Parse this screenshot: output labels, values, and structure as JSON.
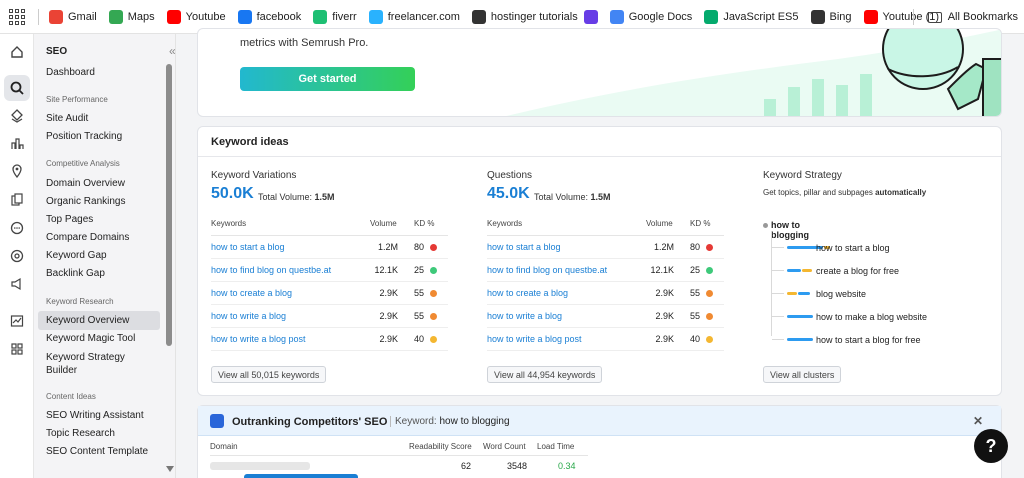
{
  "bookmarks": {
    "items": [
      {
        "label": "Gmail",
        "icon": "gmail-icon",
        "color": "#ea4335"
      },
      {
        "label": "Maps",
        "icon": "maps-icon",
        "color": "#34a853"
      },
      {
        "label": "Youtube",
        "icon": "youtube-icon",
        "color": "#ff0000"
      },
      {
        "label": "facebook",
        "icon": "facebook-icon",
        "color": "#1877f2"
      },
      {
        "label": "fiverr",
        "icon": "fiverr-icon",
        "color": "#1dbf73"
      },
      {
        "label": "freelancer.com",
        "icon": "freelancer-icon",
        "color": "#29b2fe"
      },
      {
        "label": "hostinger tutorials",
        "icon": "globe-icon",
        "color": "#333333"
      },
      {
        "label": "",
        "icon": "hostinger-icon",
        "color": "#673de6"
      },
      {
        "label": "Google Docs",
        "icon": "docs-icon",
        "color": "#4285f4"
      },
      {
        "label": "JavaScript ES5",
        "icon": "w3schools-icon",
        "color": "#04aa6d"
      },
      {
        "label": "Bing",
        "icon": "globe-icon",
        "color": "#333333"
      },
      {
        "label": "Youtube (1)",
        "icon": "youtube-icon",
        "color": "#ff0000"
      }
    ],
    "all_bookmarks": "All Bookmarks"
  },
  "nav": {
    "title": "SEO",
    "dashboard": "Dashboard",
    "site_performance": {
      "heading": "Site Performance",
      "items": [
        "Site Audit",
        "Position Tracking"
      ]
    },
    "competitive": {
      "heading": "Competitive Analysis",
      "items": [
        "Domain Overview",
        "Organic Rankings",
        "Top Pages",
        "Compare Domains",
        "Keyword Gap",
        "Backlink Gap"
      ]
    },
    "keyword_research": {
      "heading": "Keyword Research",
      "items": [
        "Keyword Overview",
        "Keyword Magic Tool",
        "Keyword Strategy Builder"
      ],
      "selected": "Keyword Overview"
    },
    "content_ideas": {
      "heading": "Content Ideas",
      "items": [
        "SEO Writing Assistant",
        "Topic Research",
        "SEO Content Template"
      ]
    }
  },
  "promo": {
    "text": "metrics with Semrush Pro.",
    "button": "Get started"
  },
  "keyword_ideas": {
    "title": "Keyword ideas",
    "variations": {
      "title": "Keyword Variations",
      "count": "50.0K",
      "volume_label": "Total Volume:",
      "volume": "1.5M",
      "columns": [
        "Keywords",
        "Volume",
        "KD %"
      ],
      "rows": [
        {
          "keyword": "how to start a blog",
          "volume": "1.2M",
          "kd": "80",
          "color": "#e53935"
        },
        {
          "keyword": "how to find blog on questbe.at",
          "volume": "12.1K",
          "kd": "25",
          "color": "#3ec97a"
        },
        {
          "keyword": "how to create a blog",
          "volume": "2.9K",
          "kd": "55",
          "color": "#f08a32"
        },
        {
          "keyword": "how to write a blog",
          "volume": "2.9K",
          "kd": "55",
          "color": "#f08a32"
        },
        {
          "keyword": "how to write a blog post",
          "volume": "2.9K",
          "kd": "40",
          "color": "#f4b731"
        }
      ],
      "view_all": "View all 50,015 keywords"
    },
    "questions": {
      "title": "Questions",
      "count": "45.0K",
      "volume_label": "Total Volume:",
      "volume": "1.5M",
      "columns": [
        "Keywords",
        "Volume",
        "KD %"
      ],
      "rows": [
        {
          "keyword": "how to start a blog",
          "volume": "1.2M",
          "kd": "80",
          "color": "#e53935"
        },
        {
          "keyword": "how to find blog on questbe.at",
          "volume": "12.1K",
          "kd": "25",
          "color": "#3ec97a"
        },
        {
          "keyword": "how to create a blog",
          "volume": "2.9K",
          "kd": "55",
          "color": "#f08a32"
        },
        {
          "keyword": "how to write a blog",
          "volume": "2.9K",
          "kd": "55",
          "color": "#f08a32"
        },
        {
          "keyword": "how to write a blog post",
          "volume": "2.9K",
          "kd": "40",
          "color": "#f4b731"
        }
      ],
      "view_all": "View all 44,954 keywords"
    },
    "strategy": {
      "title": "Keyword Strategy",
      "subtitle_prefix": "Get topics, pillar and subpages",
      "subtitle_bold": "automatically",
      "root": "how to blogging",
      "items": [
        "how to start a blog",
        "create a blog for free",
        "blog website",
        "how to make a blog website",
        "how to start a blog for free"
      ],
      "view_all": "View all clusters"
    }
  },
  "outranking": {
    "title": "Outranking Competitors' SEO",
    "keyword_label": "Keyword:",
    "keyword": "how to blogging",
    "columns": [
      "Domain",
      "Readability Score",
      "Word Count",
      "Load Time"
    ],
    "first_row": {
      "readability": "62",
      "word_count": "3548",
      "load_time": "0.34"
    }
  },
  "help": "?"
}
